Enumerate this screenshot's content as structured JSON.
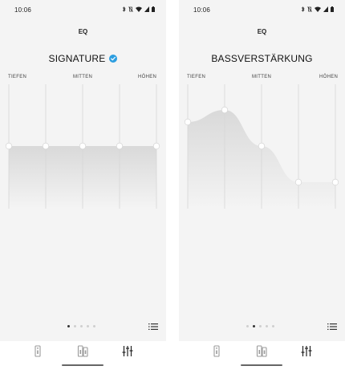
{
  "screens": [
    {
      "status": {
        "time": "10:06"
      },
      "title": "EQ",
      "preset": {
        "name": "SIGNATURE",
        "selected": true
      },
      "bands": {
        "low": "TIEFEN",
        "mid": "MITTEN",
        "high": "HÖHEN"
      },
      "eq_levels": [
        0,
        0,
        0,
        0,
        0
      ],
      "pager": {
        "count": 5,
        "active": 0
      },
      "icons": {
        "list": "list-icon",
        "nav": [
          "speaker-single-icon",
          "speaker-pair-icon",
          "equalizer-icon"
        ]
      },
      "nav_active": 2
    },
    {
      "status": {
        "time": "10:06"
      },
      "title": "EQ",
      "preset": {
        "name": "BASSVERSTÄRKUNG",
        "selected": false
      },
      "bands": {
        "low": "TIEFEN",
        "mid": "MITTEN",
        "high": "HÖHEN"
      },
      "eq_levels": [
        0.4,
        0.6,
        0,
        -0.6,
        -0.6
      ],
      "pager": {
        "count": 5,
        "active": 1
      },
      "icons": {
        "list": "list-icon",
        "nav": [
          "speaker-single-icon",
          "speaker-pair-icon",
          "equalizer-icon"
        ]
      },
      "nav_active": 2
    }
  ],
  "colors": {
    "accent": "#2d9ee0",
    "curve_fill": "#d9d9d9",
    "background": "#f4f4f4"
  }
}
